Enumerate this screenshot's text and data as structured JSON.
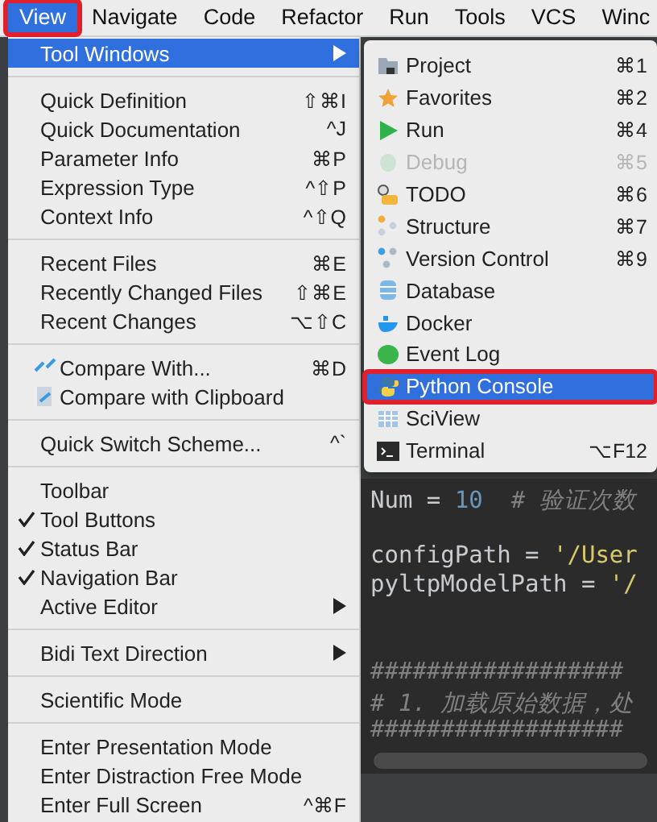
{
  "menu_bar": [
    {
      "label": "View",
      "selected": true,
      "annotated": true
    },
    {
      "label": "Navigate",
      "selected": false,
      "annotated": false
    },
    {
      "label": "Code",
      "selected": false,
      "annotated": false
    },
    {
      "label": "Refactor",
      "selected": false,
      "annotated": false
    },
    {
      "label": "Run",
      "selected": false,
      "annotated": false
    },
    {
      "label": "Tools",
      "selected": false,
      "annotated": false
    },
    {
      "label": "VCS",
      "selected": false,
      "annotated": false
    },
    {
      "label": "Winc",
      "selected": false,
      "annotated": false
    }
  ],
  "view_menu": [
    {
      "kind": "item",
      "label": "Tool Windows",
      "selected": true,
      "submenu": true
    },
    {
      "kind": "separator"
    },
    {
      "kind": "item",
      "label": "Quick Definition",
      "shortcut": "⇧⌘I",
      "selected": false
    },
    {
      "kind": "item",
      "label": "Quick Documentation",
      "shortcut": "^J",
      "selected": false
    },
    {
      "kind": "item",
      "label": "Parameter Info",
      "shortcut": "⌘P",
      "selected": false
    },
    {
      "kind": "item",
      "label": "Expression Type",
      "shortcut": "^⇧P",
      "selected": false
    },
    {
      "kind": "item",
      "label": "Context Info",
      "shortcut": "^⇧Q",
      "selected": false
    },
    {
      "kind": "separator"
    },
    {
      "kind": "item",
      "label": "Recent Files",
      "shortcut": "⌘E",
      "selected": false
    },
    {
      "kind": "item",
      "label": "Recently Changed Files",
      "shortcut": "⇧⌘E",
      "selected": false
    },
    {
      "kind": "item",
      "label": "Recent Changes",
      "shortcut": "⌥⇧C",
      "selected": false
    },
    {
      "kind": "separator"
    },
    {
      "kind": "item",
      "label": "Compare With...",
      "shortcut": "⌘D",
      "selected": false
    },
    {
      "kind": "item",
      "label": "Compare with Clipboard",
      "selected": false
    },
    {
      "kind": "separator"
    },
    {
      "kind": "item",
      "label": "Quick Switch Scheme...",
      "shortcut": "^`",
      "selected": false
    },
    {
      "kind": "separator"
    },
    {
      "kind": "item",
      "label": "Toolbar",
      "checked": false,
      "selected": false
    },
    {
      "kind": "item",
      "label": "Tool Buttons",
      "checked": true,
      "selected": false
    },
    {
      "kind": "item",
      "label": "Status Bar",
      "checked": true,
      "selected": false
    },
    {
      "kind": "item",
      "label": "Navigation Bar",
      "checked": true,
      "selected": false
    },
    {
      "kind": "item",
      "label": "Active Editor",
      "submenu": true,
      "selected": false
    },
    {
      "kind": "separator"
    },
    {
      "kind": "item",
      "label": "Bidi Text Direction",
      "submenu": true,
      "selected": false
    },
    {
      "kind": "separator"
    },
    {
      "kind": "item",
      "label": "Scientific Mode",
      "selected": false
    },
    {
      "kind": "separator"
    },
    {
      "kind": "item",
      "label": "Enter Presentation Mode",
      "selected": false
    },
    {
      "kind": "item",
      "label": "Enter Distraction Free Mode",
      "selected": false
    },
    {
      "kind": "item",
      "label": "Enter Full Screen",
      "shortcut": "^⌘F",
      "selected": false
    }
  ],
  "tool_windows_menu": [
    {
      "label": "Project",
      "shortcut": "⌘1",
      "disabled": false,
      "selected": false,
      "annotated": false
    },
    {
      "label": "Favorites",
      "shortcut": "⌘2",
      "disabled": false,
      "selected": false,
      "annotated": false
    },
    {
      "label": "Run",
      "shortcut": "⌘4",
      "disabled": false,
      "selected": false,
      "annotated": false
    },
    {
      "label": "Debug",
      "shortcut": "⌘5",
      "disabled": true,
      "selected": false,
      "annotated": false
    },
    {
      "label": "TODO",
      "shortcut": "⌘6",
      "disabled": false,
      "selected": false,
      "annotated": false
    },
    {
      "label": "Structure",
      "shortcut": "⌘7",
      "disabled": false,
      "selected": false,
      "annotated": false
    },
    {
      "label": "Version Control",
      "shortcut": "⌘9",
      "disabled": false,
      "selected": false,
      "annotated": false
    },
    {
      "label": "Database",
      "disabled": false,
      "selected": false,
      "annotated": false
    },
    {
      "label": "Docker",
      "disabled": false,
      "selected": false,
      "annotated": false
    },
    {
      "label": "Event Log",
      "disabled": false,
      "selected": false,
      "annotated": false
    },
    {
      "label": "Python Console",
      "disabled": false,
      "selected": true,
      "annotated": true
    },
    {
      "label": "SciView",
      "disabled": false,
      "selected": false,
      "annotated": false
    },
    {
      "label": "Terminal",
      "shortcut": "⌥F12",
      "disabled": false,
      "selected": false,
      "annotated": false
    }
  ],
  "editor": {
    "lines": [
      {
        "kind": "code",
        "tokens": [
          {
            "kind": "name",
            "text": "Num = "
          },
          {
            "kind": "number",
            "text": "10"
          },
          {
            "kind": "comment",
            "text": "  # 验证次数"
          }
        ]
      },
      {
        "kind": "blank"
      },
      {
        "kind": "code",
        "tokens": [
          {
            "kind": "name",
            "text": "configPath = "
          },
          {
            "kind": "string",
            "text": "'/User"
          }
        ]
      },
      {
        "kind": "code",
        "tokens": [
          {
            "kind": "name",
            "text": "pyltpModelPath = "
          },
          {
            "kind": "string",
            "text": "'/"
          }
        ]
      },
      {
        "kind": "blank"
      },
      {
        "kind": "blank"
      },
      {
        "kind": "code",
        "tokens": [
          {
            "kind": "comment",
            "text": "##################"
          }
        ]
      },
      {
        "kind": "code",
        "tokens": [
          {
            "kind": "comment",
            "text": "# 1. 加载原始数据，处"
          }
        ]
      },
      {
        "kind": "code",
        "tokens": [
          {
            "kind": "comment",
            "text": "##################"
          }
        ]
      }
    ]
  }
}
